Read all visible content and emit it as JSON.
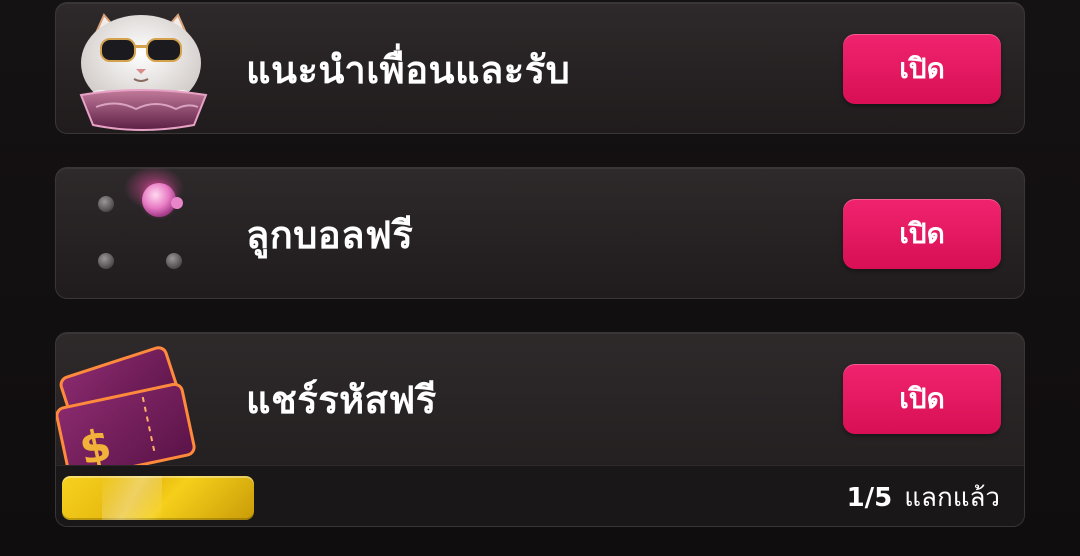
{
  "rewards": [
    {
      "title": "แนะนำเพื่อนและรับ",
      "button_label": "เปิด",
      "icon": "lucky-cat-icon"
    },
    {
      "title": "ลูกบอลฟรี",
      "button_label": "เปิด",
      "icon": "pink-ball-icon"
    },
    {
      "title": "แชร์รหัสฟรี",
      "button_label": "เปิด",
      "icon": "ticket-icon",
      "progress": {
        "count": "1/5",
        "label": "แลกแล้ว",
        "fraction": 0.2
      }
    }
  ],
  "colors": {
    "accent": "#e0135c",
    "progress": "#f0c816",
    "card": "#2a2627"
  }
}
